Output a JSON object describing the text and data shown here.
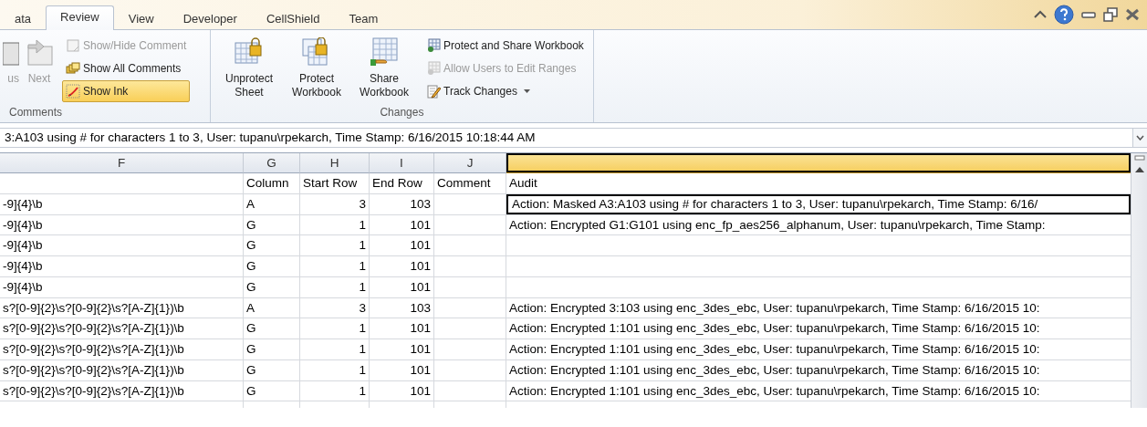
{
  "tabs": [
    {
      "label": "ata",
      "selected": false
    },
    {
      "label": "Review",
      "selected": true
    },
    {
      "label": "View",
      "selected": false
    },
    {
      "label": "Developer",
      "selected": false
    },
    {
      "label": "CellShield",
      "selected": false
    },
    {
      "label": "Team",
      "selected": false
    }
  ],
  "ribbon": {
    "groups": [
      {
        "label": "Comments",
        "buttons": [
          {
            "label": "us",
            "kind": "large",
            "disabled": true,
            "on": false
          },
          {
            "label": "Next",
            "kind": "large",
            "disabled": true,
            "on": false
          },
          {
            "label": "Show/Hide Comment",
            "kind": "small",
            "disabled": true,
            "on": false
          },
          {
            "label": "Show All Comments",
            "kind": "small",
            "disabled": false,
            "on": false
          },
          {
            "label": "Show Ink",
            "kind": "small",
            "disabled": false,
            "on": true
          }
        ]
      },
      {
        "label": "Changes",
        "buttons": [
          {
            "label": "Unprotect Sheet",
            "kind": "large",
            "disabled": false,
            "on": false
          },
          {
            "label": "Protect Workbook",
            "kind": "large",
            "disabled": false,
            "on": false
          },
          {
            "label": "Share Workbook",
            "kind": "large",
            "disabled": false,
            "on": false
          },
          {
            "label": "Protect and Share Workbook",
            "kind": "small",
            "disabled": false,
            "on": false
          },
          {
            "label": "Allow Users to Edit Ranges",
            "kind": "small",
            "disabled": true,
            "on": false
          },
          {
            "label": "Track Changes",
            "kind": "small",
            "disabled": false,
            "on": false,
            "dropdown": true
          }
        ]
      }
    ]
  },
  "formula_bar": {
    "value": "3:A103 using # for characters 1 to 3, User: tupanu\\rpekarch, Time Stamp: 6/16/2015 10:18:44 AM"
  },
  "sheet": {
    "columns": [
      {
        "label": "F",
        "selected": false
      },
      {
        "label": "G",
        "selected": false
      },
      {
        "label": "H",
        "selected": false
      },
      {
        "label": "I",
        "selected": false
      },
      {
        "label": "J",
        "selected": false
      },
      {
        "selected": true
      }
    ],
    "rows": [
      {
        "kind": "header",
        "selected": false,
        "G": "Column",
        "H": "Start Row",
        "I": "End Row",
        "J": "Comment",
        "K": "Audit"
      },
      {
        "kind": "data",
        "selected": true,
        "F": "-9]{4}\\b",
        "G": "A",
        "H": "3",
        "I": "103",
        "K": "Action: Masked A3:A103 using # for characters 1 to 3, User: tupanu\\rpekarch, Time Stamp: 6/16/"
      },
      {
        "kind": "data",
        "selected": false,
        "F": "-9]{4}\\b",
        "G": "G",
        "H": "1",
        "I": "101",
        "K": "Action: Encrypted G1:G101 using enc_fp_aes256_alphanum, User: tupanu\\rpekarch, Time Stamp:"
      },
      {
        "kind": "data",
        "selected": false,
        "F": "-9]{4}\\b",
        "G": "G",
        "H": "1",
        "I": "101"
      },
      {
        "kind": "data",
        "selected": false,
        "F": "-9]{4}\\b",
        "G": "G",
        "H": "1",
        "I": "101"
      },
      {
        "kind": "data",
        "selected": false,
        "F": "-9]{4}\\b",
        "G": "G",
        "H": "1",
        "I": "101"
      },
      {
        "kind": "data",
        "selected": false,
        "F": "s?[0-9]{2}\\s?[0-9]{2}\\s?[A-Z]{1})\\b",
        "G": "A",
        "H": "3",
        "I": "103",
        "K": "Action: Encrypted 3:103 using enc_3des_ebc, User: tupanu\\rpekarch, Time Stamp: 6/16/2015 10:"
      },
      {
        "kind": "data",
        "selected": false,
        "F": "s?[0-9]{2}\\s?[0-9]{2}\\s?[A-Z]{1})\\b",
        "G": "G",
        "H": "1",
        "I": "101",
        "K": "Action: Encrypted 1:101 using enc_3des_ebc, User: tupanu\\rpekarch, Time Stamp: 6/16/2015 10:"
      },
      {
        "kind": "data",
        "selected": false,
        "F": "s?[0-9]{2}\\s?[0-9]{2}\\s?[A-Z]{1})\\b",
        "G": "G",
        "H": "1",
        "I": "101",
        "K": "Action: Encrypted 1:101 using enc_3des_ebc, User: tupanu\\rpekarch, Time Stamp: 6/16/2015 10:"
      },
      {
        "kind": "data",
        "selected": false,
        "F": "s?[0-9]{2}\\s?[0-9]{2}\\s?[A-Z]{1})\\b",
        "G": "G",
        "H": "1",
        "I": "101",
        "K": "Action: Encrypted 1:101 using enc_3des_ebc, User: tupanu\\rpekarch, Time Stamp: 6/16/2015 10:"
      },
      {
        "kind": "data",
        "selected": false,
        "F": "s?[0-9]{2}\\s?[0-9]{2}\\s?[A-Z]{1})\\b",
        "G": "G",
        "H": "1",
        "I": "101",
        "K": "Action: Encrypted 1:101 using enc_3des_ebc, User: tupanu\\rpekarch, Time Stamp: 6/16/2015 10:"
      }
    ]
  }
}
